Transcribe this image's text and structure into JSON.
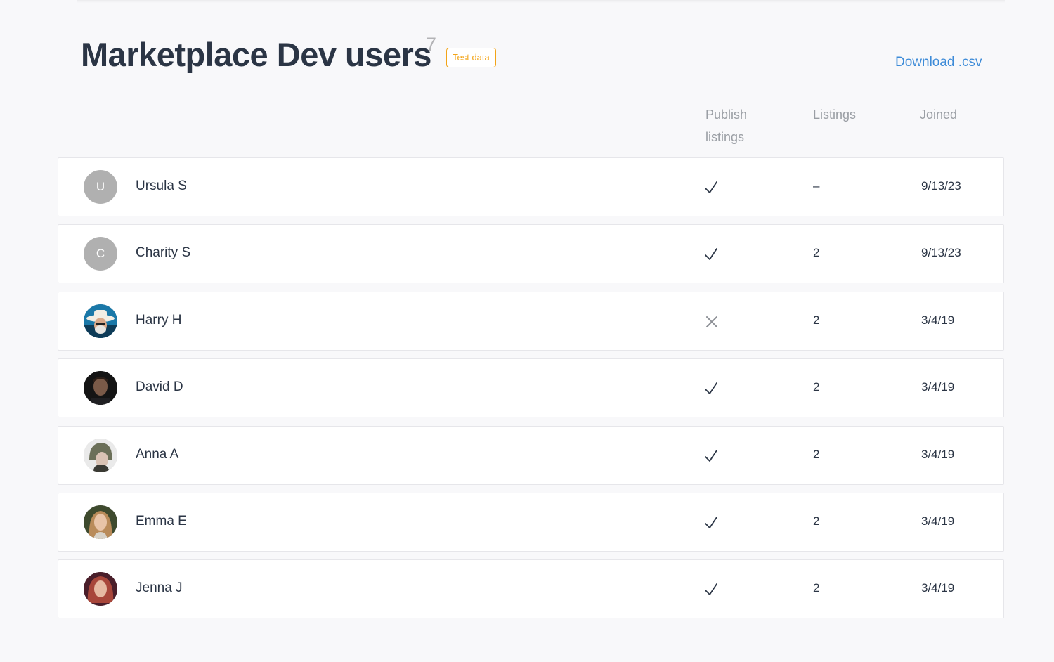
{
  "header": {
    "title": "Marketplace Dev users",
    "count": "7",
    "badge": "Test data",
    "download_label": "Download .csv"
  },
  "columns": {
    "publish": "Publish listings",
    "listings": "Listings",
    "joined": "Joined"
  },
  "users": [
    {
      "name": "Ursula S",
      "initial": "U",
      "avatar": "initial",
      "publish": "check",
      "listings": "–",
      "joined": "9/13/23"
    },
    {
      "name": "Charity S",
      "initial": "C",
      "avatar": "initial",
      "publish": "check",
      "listings": "2",
      "joined": "9/13/23"
    },
    {
      "name": "Harry H",
      "initial": "",
      "avatar": "photo",
      "publish": "cross",
      "listings": "2",
      "joined": "3/4/19"
    },
    {
      "name": "David D",
      "initial": "",
      "avatar": "photo",
      "publish": "check",
      "listings": "2",
      "joined": "3/4/19"
    },
    {
      "name": "Anna A",
      "initial": "",
      "avatar": "photo",
      "publish": "check",
      "listings": "2",
      "joined": "3/4/19"
    },
    {
      "name": "Emma E",
      "initial": "",
      "avatar": "photo",
      "publish": "check",
      "listings": "2",
      "joined": "3/4/19"
    },
    {
      "name": "Jenna J",
      "initial": "",
      "avatar": "photo",
      "publish": "check",
      "listings": "2",
      "joined": "3/4/19"
    }
  ],
  "colors": {
    "accent_link": "#3d8bd8",
    "badge": "#f2a418",
    "avatar_placeholder": "#b0b0b0"
  }
}
